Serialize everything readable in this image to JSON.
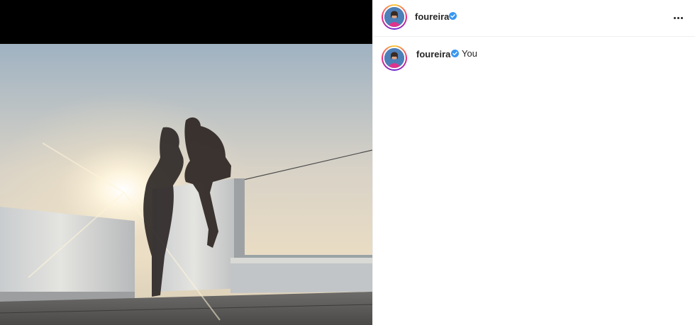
{
  "post": {
    "username": "foureira",
    "verified": true,
    "caption": "You"
  },
  "colors": {
    "verified_blue": "#3897f0",
    "text": "#262626",
    "divider": "#efefef"
  },
  "icons": {
    "verified": "verified-badge-icon",
    "more": "more-options-icon"
  }
}
